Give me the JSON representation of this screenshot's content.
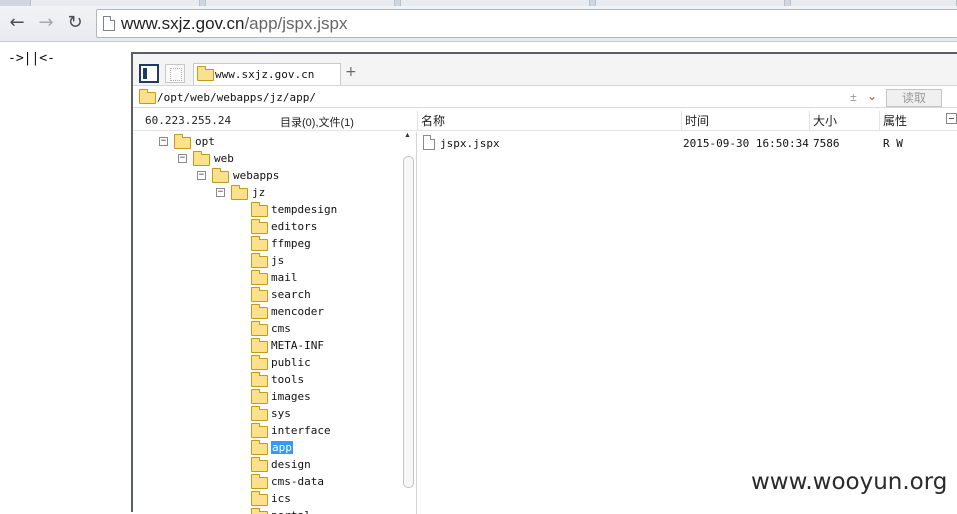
{
  "browser": {
    "back_icon": "arrow-left-icon",
    "forward_icon": "arrow-right-icon",
    "reload_icon": "reload-icon",
    "url_host": "www.sxjz.gov.cn",
    "url_path": "/app/jspx.jspx"
  },
  "page": {
    "left_text": "->||<-"
  },
  "app": {
    "tab_label": "www.sxjz.gov.cn",
    "new_tab_symbol": "+",
    "path": "/opt/web/webapps/jz/app/",
    "path_controls": "±",
    "read_button": "读取",
    "server_ip": "60.223.255.24",
    "summary": "目录(0),文件(1)",
    "columns": {
      "name": "名称",
      "time": "时间",
      "size": "大小",
      "attr": "属性"
    },
    "tree": {
      "expand_symbol": "⊟",
      "ancestors": [
        "opt",
        "web",
        "webapps",
        "jz"
      ],
      "children": [
        "tempdesign",
        "editors",
        "ffmpeg",
        "js",
        "mail",
        "search",
        "mencoder",
        "cms",
        "META-INF",
        "public",
        "tools",
        "images",
        "sys",
        "interface",
        "app",
        "design",
        "cms-data",
        "ics",
        "portal"
      ],
      "selected": "app"
    },
    "files": [
      {
        "name": "jspx.jspx",
        "time": "2015-09-30 16:50:34",
        "size": "7586",
        "attr": "R W"
      }
    ]
  },
  "watermark": "www.wooyun.org",
  "colors": {
    "selection": "#3399ff",
    "folder_fill": "#fbe08e",
    "folder_border": "#c49a1d"
  }
}
